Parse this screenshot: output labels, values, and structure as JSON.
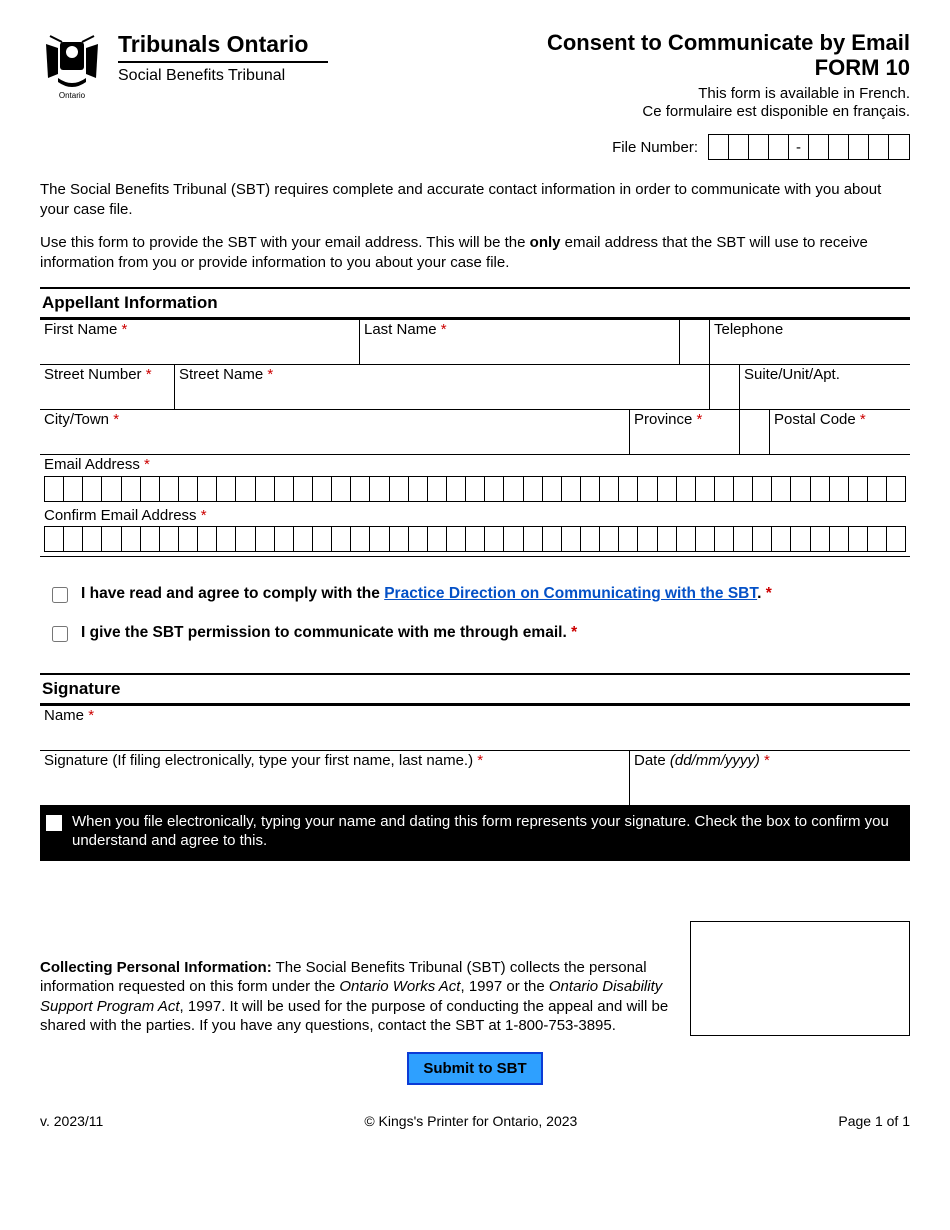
{
  "header": {
    "brand": "Tribunals Ontario",
    "subbrand": "Social Benefits Tribunal",
    "coat_label": "Ontario",
    "title_line1": "Consent to Communicate by Email",
    "title_line2": "FORM 10",
    "lang_en": "This form is available in French.",
    "lang_fr": "Ce formulaire est disponible en français.",
    "file_number_label": "File Number:",
    "file_number_dash": "-"
  },
  "intro": {
    "p1": "The Social Benefits Tribunal (SBT) requires complete and accurate contact information in order to communicate with you about your case file.",
    "p2_a": "Use this form to provide the SBT with your email address.  This will be the ",
    "p2_b": "only",
    "p2_c": " email address that the SBT will use to receive information from you or provide information to you about your case file."
  },
  "appellant": {
    "heading": "Appellant Information",
    "first_name": "First Name",
    "last_name": "Last Name",
    "telephone": "Telephone",
    "street_number": "Street Number",
    "street_name": "Street Name",
    "suite": "Suite/Unit/Apt.",
    "city": "City/Town",
    "province": "Province",
    "postal": "Postal Code",
    "email": "Email Address",
    "confirm_email": "Confirm Email Address",
    "star": "*"
  },
  "checks": {
    "line1_a": "I have read and agree to comply with the ",
    "line1_link": "Practice Direction on Communicating with the SBT",
    "line1_b": ".",
    "line2": "I give the SBT permission to communicate with me through email."
  },
  "signature": {
    "heading": "Signature",
    "name": "Name",
    "sig_label": "Signature (If filing electronically, type your first name, last name.)",
    "date_label_a": "Date ",
    "date_label_b": "(dd/mm/yyyy)",
    "consent_text": "When you file electronically, typing your name and dating this form represents your signature.  Check the box to confirm you understand and agree to this."
  },
  "pi": {
    "head": "Collecting Personal Information:",
    "body_a": "  The Social Benefits Tribunal (SBT) collects the personal information requested on this form under the ",
    "act1": "Ontario Works Act",
    "body_b": ", 1997 or the ",
    "act2": "Ontario Disability Support Program Act",
    "body_c": ", 1997.  It will be used for the purpose of conducting the appeal and will be shared with the parties.  If you have any questions, contact the SBT at 1-800-753-3895."
  },
  "submit_label": "Submit to SBT",
  "footer": {
    "version": "v. 2023/11",
    "copyright": "© Kings's Printer for Ontario, 2023",
    "page": "Page 1 of 1"
  }
}
